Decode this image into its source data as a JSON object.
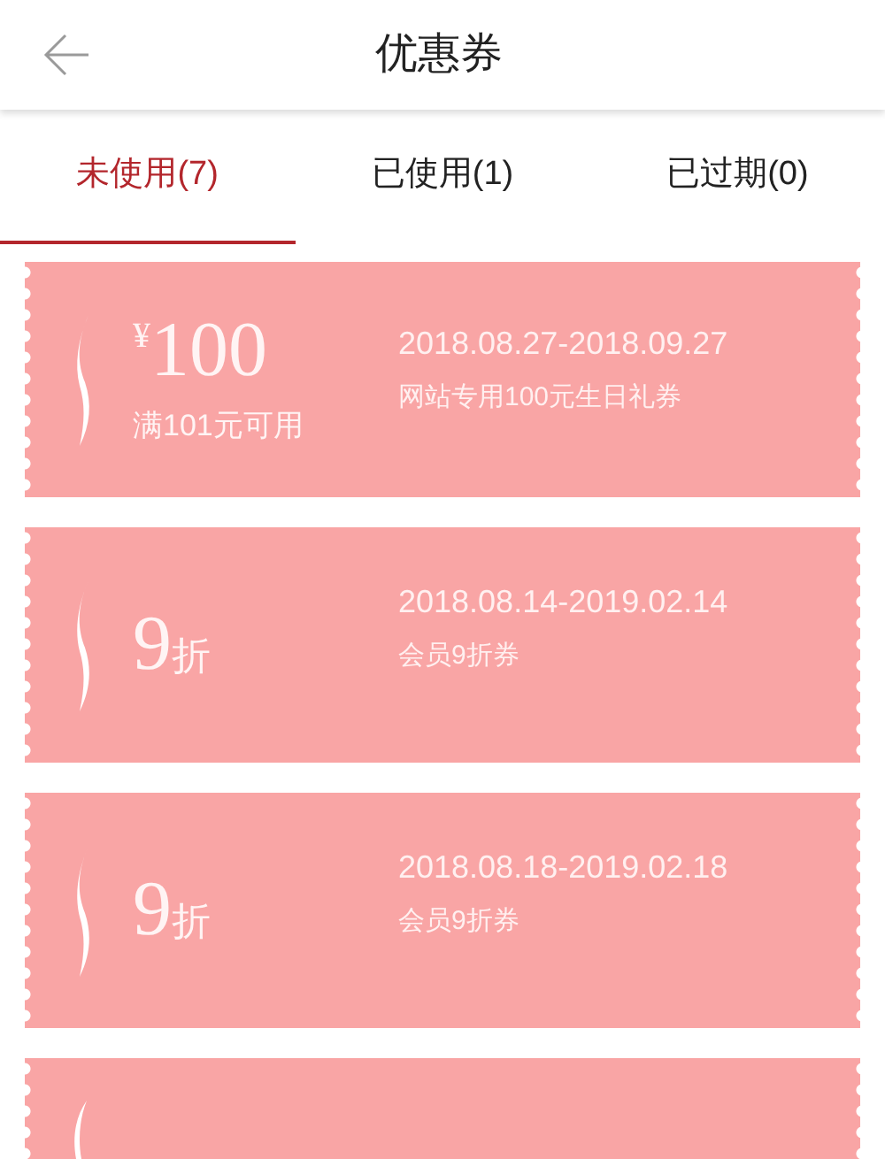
{
  "header": {
    "title": "优惠券"
  },
  "tabs": [
    {
      "label": "未使用(7)",
      "selected": true
    },
    {
      "label": "已使用(1)",
      "selected": false
    },
    {
      "label": "已过期(0)",
      "selected": false
    }
  ],
  "coupons": [
    {
      "kind": "amount",
      "currency": "¥",
      "value": "100",
      "condition": "满101元可用",
      "period": "2018.08.27-2018.09.27",
      "description": "网站专用100元生日礼券"
    },
    {
      "kind": "discount",
      "value": "9",
      "unit": "折",
      "period": "2018.08.14-2019.02.14",
      "description": "会员9折券"
    },
    {
      "kind": "discount",
      "value": "9",
      "unit": "折",
      "period": "2018.08.18-2019.02.18",
      "description": "会员9折券"
    },
    {
      "kind": "cut"
    }
  ]
}
